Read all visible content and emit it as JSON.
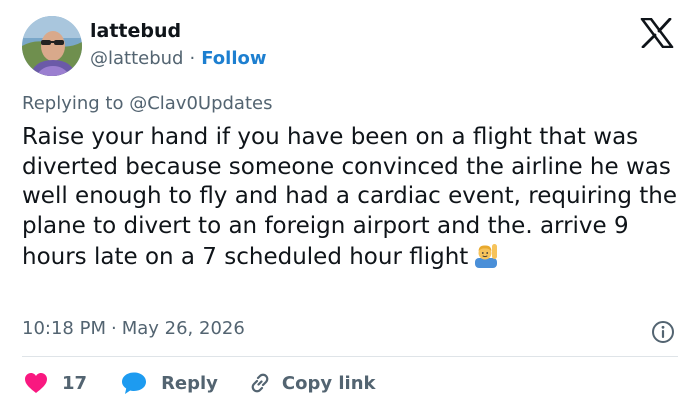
{
  "author": {
    "name": "lattebud",
    "handle": "@lattebud",
    "separator": "·",
    "follow_label": "Follow"
  },
  "reply_context": {
    "prefix": "Replying to ",
    "mention": "@Clav0Updates"
  },
  "tweet": {
    "text": "Raise your hand if you have been on a flight that was diverted because someone convinced the airline he was well enough to fly and had a cardiac event, requiring the plane to divert to an foreign airport and the. arrive 9 hours late on a 7 scheduled hour flight",
    "emoji": "person-raising-hand"
  },
  "meta": {
    "time": "10:18 PM",
    "separator": "·",
    "date": "May 26, 2026"
  },
  "actions": {
    "like_count": "17",
    "reply_label": "Reply",
    "copy_label": "Copy link"
  },
  "colors": {
    "accent": "#1d7fd0",
    "like": "#f91880",
    "reply": "#1d9bf0",
    "muted": "#536471",
    "text": "#0f1419"
  }
}
